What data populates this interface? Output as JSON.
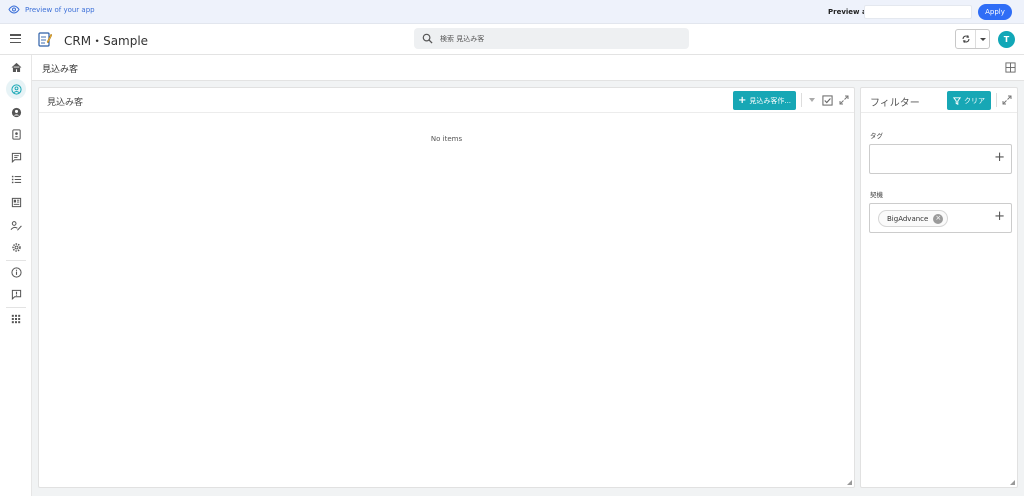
{
  "preview": {
    "label": "Preview of your app",
    "preview_as_label": "Preview as:",
    "preview_as_value": "",
    "apply_label": "Apply"
  },
  "header": {
    "app_title": "CRM・Sample",
    "search_placeholder": "検索 見込み客",
    "avatar_initial": "T"
  },
  "sidebar": {
    "items": [
      {
        "icon": "home-icon"
      },
      {
        "icon": "person-circle-icon",
        "active": true
      },
      {
        "icon": "account-circle-icon"
      },
      {
        "icon": "contact-card-icon"
      },
      {
        "icon": "chat-icon"
      },
      {
        "icon": "checklist-icon"
      },
      {
        "icon": "newspaper-icon"
      },
      {
        "icon": "person-edit-icon"
      },
      {
        "icon": "settings-icon"
      },
      {
        "icon": "info-icon"
      },
      {
        "icon": "feedback-icon"
      },
      {
        "icon": "apps-grid-icon"
      }
    ]
  },
  "page": {
    "title": "見込み客"
  },
  "main_panel": {
    "title": "見込み客",
    "new_button_label": "見込み客作...",
    "empty_text": "No items"
  },
  "filter_panel": {
    "title": "フィルター",
    "clear_label": "クリア",
    "fields": [
      {
        "label": "タグ",
        "chips": []
      },
      {
        "label": "契機",
        "chips": [
          "BigAdvance"
        ]
      }
    ]
  },
  "colors": {
    "accent": "#17a7b5",
    "apply_button": "#2f6df6",
    "preview_text": "#3b6fd8",
    "avatar": "#11a7b7"
  }
}
